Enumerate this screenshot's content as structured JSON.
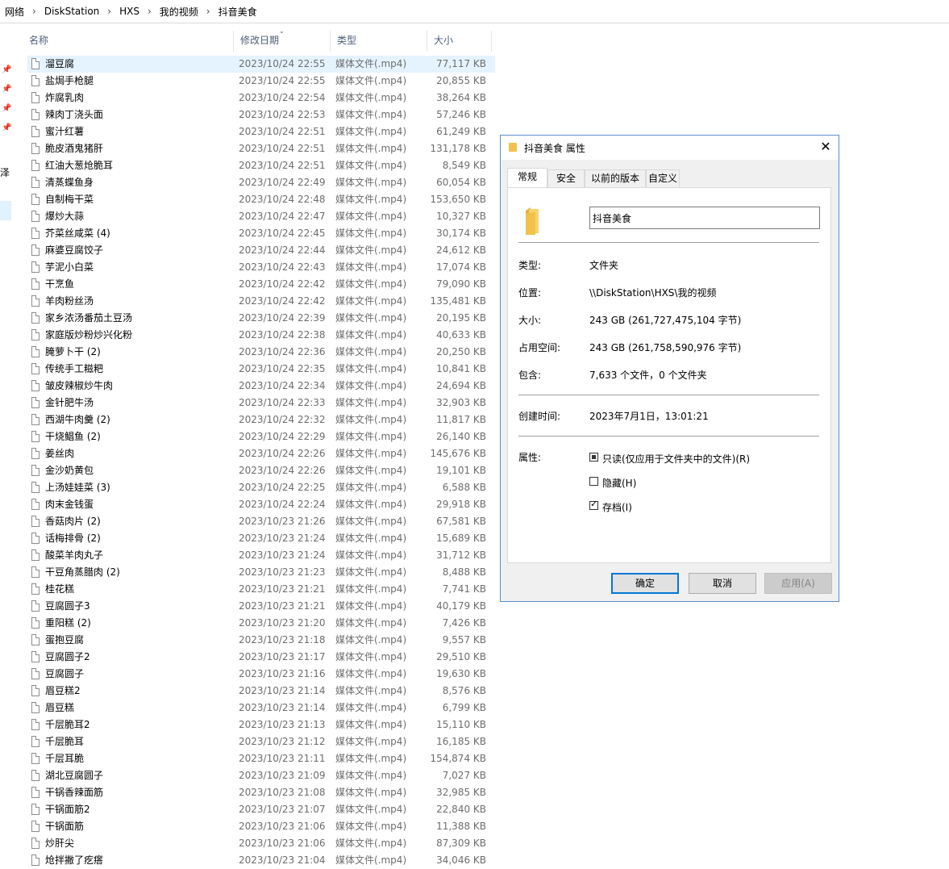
{
  "breadcrumb": [
    "网络",
    "DiskStation",
    "HXS",
    "我的视频",
    "抖音美食"
  ],
  "columns": {
    "name": "名称",
    "date": "修改日期",
    "type": "类型",
    "size": "大小"
  },
  "nav": {
    "clipped_text": "泽"
  },
  "files": [
    {
      "name": "溜豆腐",
      "date": "2023/10/24 22:55",
      "type": "媒体文件(.mp4)",
      "size": "77,117 KB"
    },
    {
      "name": "盐焗手枪腿",
      "date": "2023/10/24 22:55",
      "type": "媒体文件(.mp4)",
      "size": "20,855 KB"
    },
    {
      "name": "炸腐乳肉",
      "date": "2023/10/24 22:54",
      "type": "媒体文件(.mp4)",
      "size": "38,264 KB"
    },
    {
      "name": "辣肉丁浇头面",
      "date": "2023/10/24 22:53",
      "type": "媒体文件(.mp4)",
      "size": "57,246 KB"
    },
    {
      "name": "蜜汁红薯",
      "date": "2023/10/24 22:51",
      "type": "媒体文件(.mp4)",
      "size": "61,249 KB"
    },
    {
      "name": "脆皮酒鬼猪肝",
      "date": "2023/10/24 22:51",
      "type": "媒体文件(.mp4)",
      "size": "131,178 KB"
    },
    {
      "name": "红油大葱炝脆耳",
      "date": "2023/10/24 22:51",
      "type": "媒体文件(.mp4)",
      "size": "8,549 KB"
    },
    {
      "name": "清蒸蝶鱼身",
      "date": "2023/10/24 22:49",
      "type": "媒体文件(.mp4)",
      "size": "60,054 KB"
    },
    {
      "name": "自制梅干菜",
      "date": "2023/10/24 22:48",
      "type": "媒体文件(.mp4)",
      "size": "153,650 KB"
    },
    {
      "name": "爆炒大蒜",
      "date": "2023/10/24 22:47",
      "type": "媒体文件(.mp4)",
      "size": "10,327 KB"
    },
    {
      "name": "芥菜丝咸菜 (4)",
      "date": "2023/10/24 22:45",
      "type": "媒体文件(.mp4)",
      "size": "30,174 KB"
    },
    {
      "name": "麻婆豆腐饺子",
      "date": "2023/10/24 22:44",
      "type": "媒体文件(.mp4)",
      "size": "24,612 KB"
    },
    {
      "name": "芋泥小白菜",
      "date": "2023/10/24 22:43",
      "type": "媒体文件(.mp4)",
      "size": "17,074 KB"
    },
    {
      "name": "干烹鱼",
      "date": "2023/10/24 22:42",
      "type": "媒体文件(.mp4)",
      "size": "79,090 KB"
    },
    {
      "name": "羊肉粉丝汤",
      "date": "2023/10/24 22:42",
      "type": "媒体文件(.mp4)",
      "size": "135,481 KB"
    },
    {
      "name": "家乡浓汤番茄土豆汤",
      "date": "2023/10/24 22:39",
      "type": "媒体文件(.mp4)",
      "size": "20,195 KB"
    },
    {
      "name": "家庭版炒粉炒兴化粉",
      "date": "2023/10/24 22:38",
      "type": "媒体文件(.mp4)",
      "size": "40,633 KB"
    },
    {
      "name": "腌萝卜干 (2)",
      "date": "2023/10/24 22:36",
      "type": "媒体文件(.mp4)",
      "size": "20,250 KB"
    },
    {
      "name": "传统手工糍粑",
      "date": "2023/10/24 22:35",
      "type": "媒体文件(.mp4)",
      "size": "10,841 KB"
    },
    {
      "name": "皱皮辣椒炒牛肉",
      "date": "2023/10/24 22:34",
      "type": "媒体文件(.mp4)",
      "size": "24,694 KB"
    },
    {
      "name": "金针肥牛汤",
      "date": "2023/10/24 22:33",
      "type": "媒体文件(.mp4)",
      "size": "32,903 KB"
    },
    {
      "name": "西湖牛肉羹 (2)",
      "date": "2023/10/24 22:32",
      "type": "媒体文件(.mp4)",
      "size": "11,817 KB"
    },
    {
      "name": "干烧鲳鱼 (2)",
      "date": "2023/10/24 22:29",
      "type": "媒体文件(.mp4)",
      "size": "26,140 KB"
    },
    {
      "name": "姜丝肉",
      "date": "2023/10/24 22:26",
      "type": "媒体文件(.mp4)",
      "size": "145,676 KB"
    },
    {
      "name": "金沙奶黄包",
      "date": "2023/10/24 22:26",
      "type": "媒体文件(.mp4)",
      "size": "19,101 KB"
    },
    {
      "name": "上汤娃娃菜 (3)",
      "date": "2023/10/24 22:25",
      "type": "媒体文件(.mp4)",
      "size": "6,588 KB"
    },
    {
      "name": "肉末金钱蛋",
      "date": "2023/10/24 22:24",
      "type": "媒体文件(.mp4)",
      "size": "29,918 KB"
    },
    {
      "name": "香菇肉片 (2)",
      "date": "2023/10/23 21:26",
      "type": "媒体文件(.mp4)",
      "size": "67,581 KB"
    },
    {
      "name": "话梅排骨 (2)",
      "date": "2023/10/23 21:24",
      "type": "媒体文件(.mp4)",
      "size": "15,689 KB"
    },
    {
      "name": "酸菜羊肉丸子",
      "date": "2023/10/23 21:24",
      "type": "媒体文件(.mp4)",
      "size": "31,712 KB"
    },
    {
      "name": "干豆角蒸腊肉 (2)",
      "date": "2023/10/23 21:23",
      "type": "媒体文件(.mp4)",
      "size": "8,488 KB"
    },
    {
      "name": "桂花糕",
      "date": "2023/10/23 21:21",
      "type": "媒体文件(.mp4)",
      "size": "7,741 KB"
    },
    {
      "name": "豆腐圆子3",
      "date": "2023/10/23 21:21",
      "type": "媒体文件(.mp4)",
      "size": "40,179 KB"
    },
    {
      "name": "重阳糕 (2)",
      "date": "2023/10/23 21:20",
      "type": "媒体文件(.mp4)",
      "size": "7,426 KB"
    },
    {
      "name": "蛋抱豆腐",
      "date": "2023/10/23 21:18",
      "type": "媒体文件(.mp4)",
      "size": "9,557 KB"
    },
    {
      "name": "豆腐圆子2",
      "date": "2023/10/23 21:17",
      "type": "媒体文件(.mp4)",
      "size": "29,510 KB"
    },
    {
      "name": "豆腐圆子",
      "date": "2023/10/23 21:16",
      "type": "媒体文件(.mp4)",
      "size": "19,630 KB"
    },
    {
      "name": "眉豆糕2",
      "date": "2023/10/23 21:14",
      "type": "媒体文件(.mp4)",
      "size": "8,576 KB"
    },
    {
      "name": "眉豆糕",
      "date": "2023/10/23 21:14",
      "type": "媒体文件(.mp4)",
      "size": "6,799 KB"
    },
    {
      "name": "千层脆耳2",
      "date": "2023/10/23 21:13",
      "type": "媒体文件(.mp4)",
      "size": "15,110 KB"
    },
    {
      "name": "千层脆耳",
      "date": "2023/10/23 21:12",
      "type": "媒体文件(.mp4)",
      "size": "16,185 KB"
    },
    {
      "name": "千层耳脆",
      "date": "2023/10/23 21:11",
      "type": "媒体文件(.mp4)",
      "size": "154,874 KB"
    },
    {
      "name": "湖北豆腐圆子",
      "date": "2023/10/23 21:09",
      "type": "媒体文件(.mp4)",
      "size": "7,027 KB"
    },
    {
      "name": "干锅香辣面筋",
      "date": "2023/10/23 21:08",
      "type": "媒体文件(.mp4)",
      "size": "32,985 KB"
    },
    {
      "name": "干锅面筋2",
      "date": "2023/10/23 21:07",
      "type": "媒体文件(.mp4)",
      "size": "22,840 KB"
    },
    {
      "name": "干锅面筋",
      "date": "2023/10/23 21:06",
      "type": "媒体文件(.mp4)",
      "size": "11,388 KB"
    },
    {
      "name": "炒肝尖",
      "date": "2023/10/23 21:06",
      "type": "媒体文件(.mp4)",
      "size": "87,309 KB"
    },
    {
      "name": "炝拌撇了疙瘩",
      "date": "2023/10/23 21:04",
      "type": "媒体文件(.mp4)",
      "size": "34,046 KB"
    }
  ],
  "dialog": {
    "title": "抖音美食 属性",
    "tabs": [
      "常规",
      "安全",
      "以前的版本",
      "自定义"
    ],
    "active_tab": "常规",
    "name_value": "抖音美食",
    "type_label": "类型:",
    "type_value": "文件夹",
    "location_label": "位置:",
    "location_value": "\\\\DiskStation\\HXS\\我的视频",
    "size_label": "大小:",
    "size_value": "243 GB (261,727,475,104 字节)",
    "disk_label": "占用空间:",
    "disk_value": "243 GB (261,758,590,976 字节)",
    "contains_label": "包含:",
    "contains_value": "7,633 个文件，0 个文件夹",
    "created_label": "创建时间:",
    "created_value": "2023年7月1日，13:01:21",
    "attributes_label": "属性:",
    "readonly_label": "只读(仅应用于文件夹中的文件)(R)",
    "readonly_state": "indeterminate",
    "hidden_label": "隐藏(H)",
    "hidden_state": "unchecked",
    "archive_label": "存档(I)",
    "archive_state": "checked",
    "ok_label": "确定",
    "cancel_label": "取消",
    "apply_label": "应用(A)"
  },
  "colors": {
    "selected_row": "#e5f3ff",
    "dialog_border": "#5b8dc9",
    "primary_button_border": "#0078d7",
    "folder_yellow": "#f0c24c"
  }
}
